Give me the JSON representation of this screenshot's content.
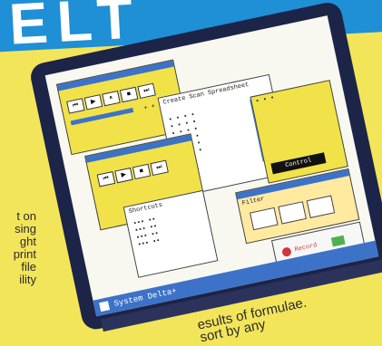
{
  "banner": {
    "text": "ELT"
  },
  "left_blurb": [
    "t on",
    "sing",
    "ght",
    "print",
    "file",
    "ility"
  ],
  "bottom_text": [
    "esults of formulae.",
    "sort by any"
  ],
  "screen": {
    "title": "Create Scan Spreadsheet",
    "taskbar": {
      "label": "System Delta+"
    },
    "panel_labels": {
      "control": "Control",
      "shortcuts": "Shortcuts",
      "filter": "Filter",
      "record": "Record"
    },
    "icons": [
      "play-icon",
      "rewind-icon",
      "forward-icon",
      "pause-icon",
      "stop-icon"
    ],
    "colors": {
      "screen": "#f8f8f0",
      "yellow": "#f1e24a",
      "blue": "#3c72c8",
      "bezel": "#1c2448"
    }
  }
}
